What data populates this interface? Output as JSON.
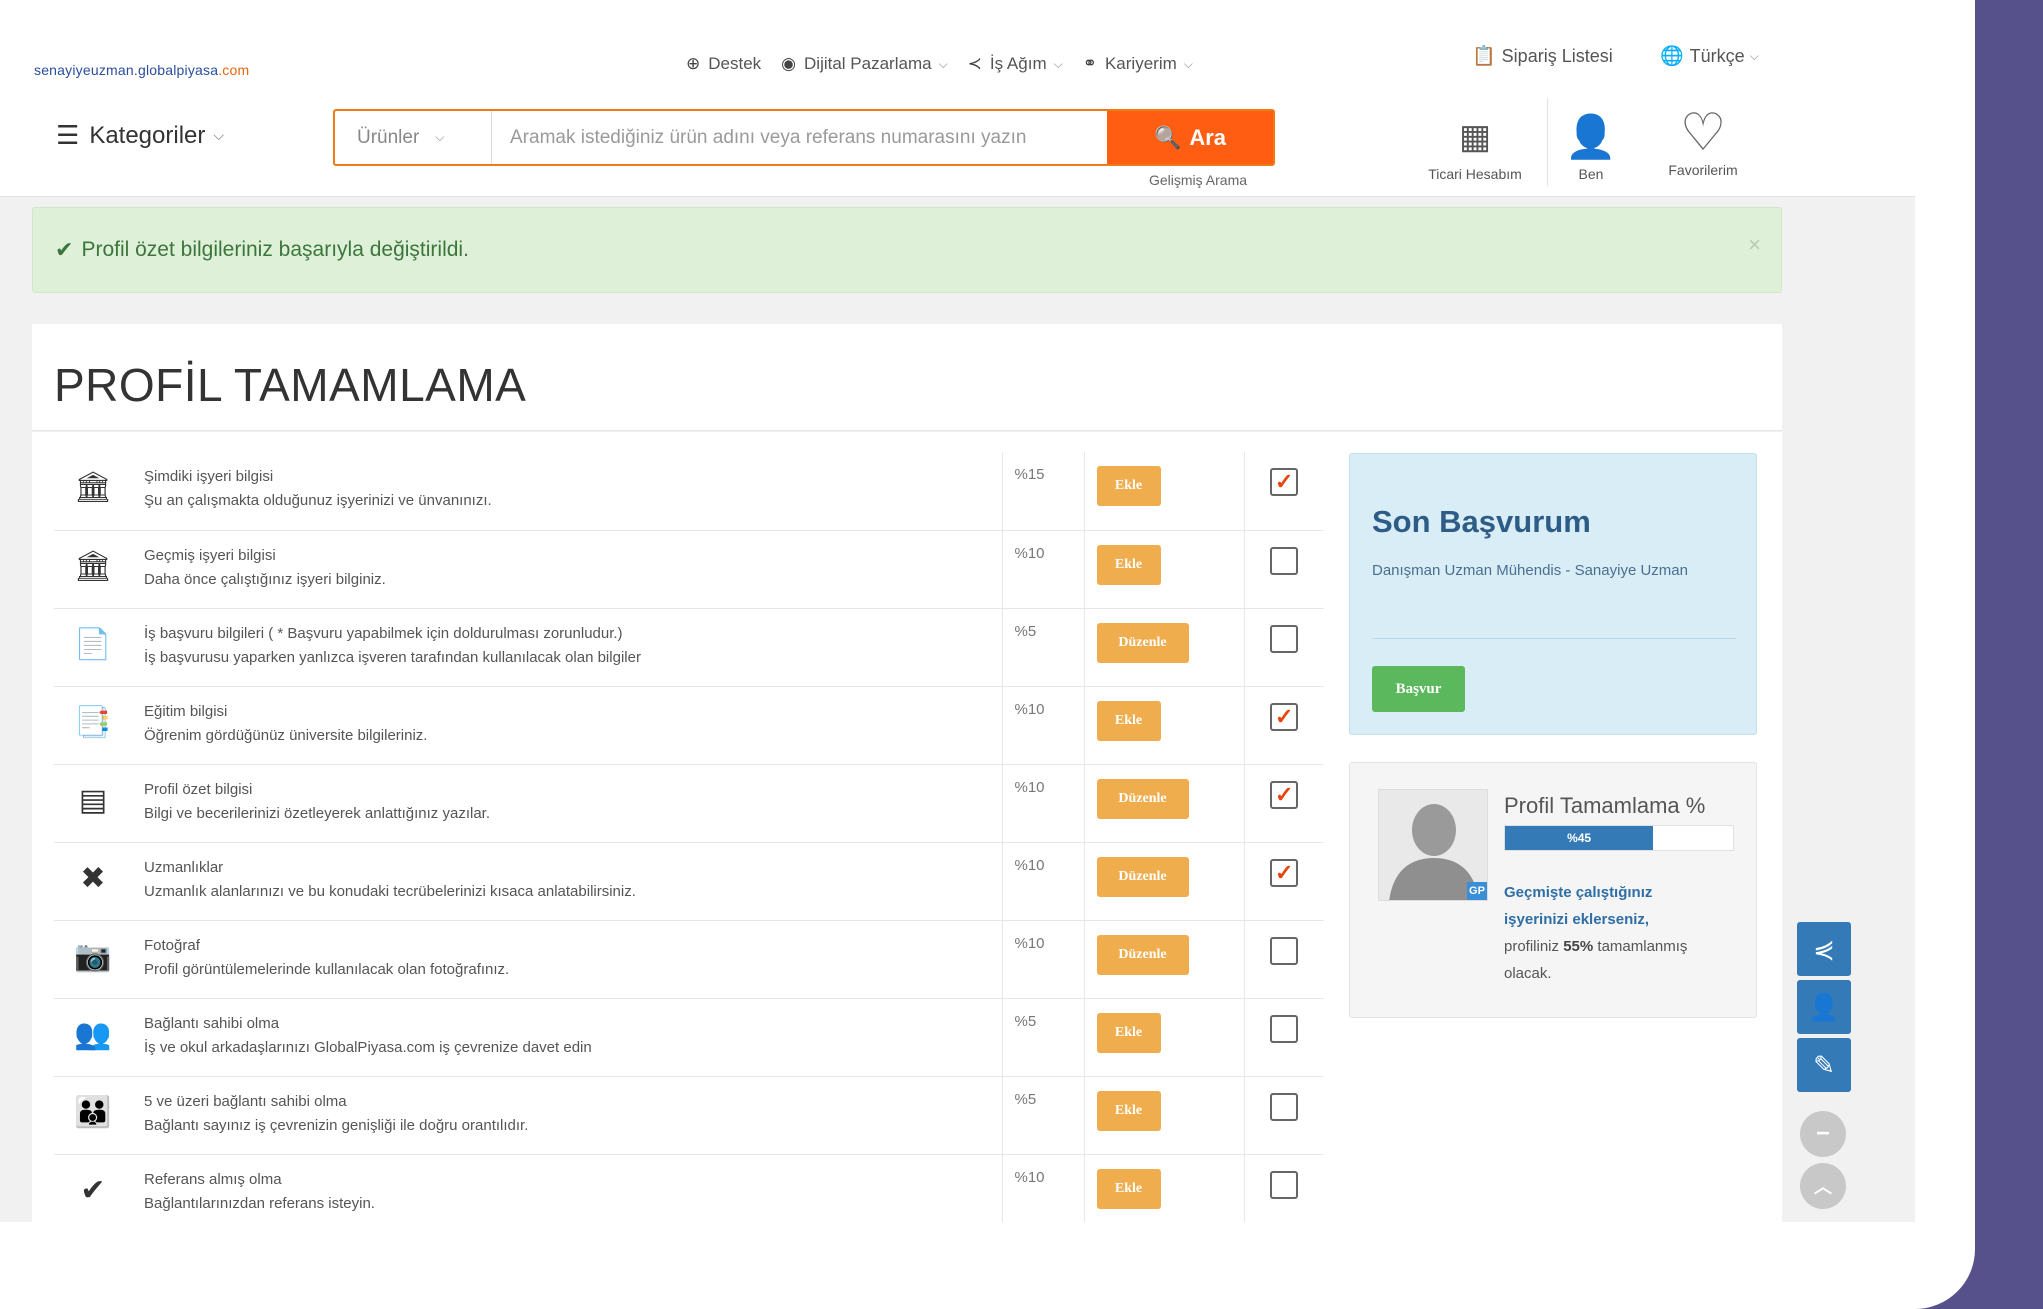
{
  "header": {
    "logo_prefix": "senayiyeuzman.globalpiyasa",
    "logo_domain": ".com",
    "nav": [
      {
        "label": "Destek",
        "icon": "⊕",
        "chevron": ""
      },
      {
        "label": "Dijital Pazarlama",
        "icon": "◉",
        "chevron": "⌵"
      },
      {
        "label": "İş Ağım",
        "icon": "≺",
        "chevron": "⌵"
      },
      {
        "label": "Kariyerim",
        "icon": "⚭",
        "chevron": "⌵"
      }
    ],
    "order_list": "Sipariş Listesi",
    "language": "Türkçe",
    "categories": "Kategoriler",
    "search_category": "Ürünler",
    "search_placeholder": "Aramak istediğiniz ürün adını veya referans numarasını yazın",
    "search_button": "Ara",
    "advanced_search": "Gelişmiş Arama",
    "account_label": "Ticari Hesabım",
    "me_label": "Ben",
    "favorites_label": "Favorilerim"
  },
  "alert": {
    "message": "Profil özet bilgileriniz başarıyla değiştirildi.",
    "close": "×"
  },
  "profile": {
    "title": "PROFİL TAMAMLAMA",
    "tasks": [
      {
        "icon": "🏛",
        "title": "Şimdiki işyeri bilgisi",
        "desc": "Şu an çalışmakta olduğunuz işyerinizi ve ünvanınızı.",
        "pct": "%15",
        "button": "Ekle",
        "checked": true
      },
      {
        "icon": "🏛",
        "title": "Geçmiş işyeri bilgisi",
        "desc": "Daha önce çalıştığınız işyeri bilginiz.",
        "pct": "%10",
        "button": "Ekle",
        "checked": false
      },
      {
        "icon": "📄",
        "title": "İş başvuru bilgileri ( * Başvuru yapabilmek için doldurulması zorunludur.)",
        "desc": "İş başvurusu yaparken yanlızca işveren tarafından kullanılacak olan bilgiler",
        "pct": "%5",
        "button": "Düzenle",
        "checked": false
      },
      {
        "icon": "📑",
        "title": "Eğitim bilgisi",
        "desc": "Öğrenim gördüğünüz üniversite bilgileriniz.",
        "pct": "%10",
        "button": "Ekle",
        "checked": true
      },
      {
        "icon": "▤",
        "title": "Profil özet bilgisi",
        "desc": "Bilgi ve becerilerinizi özetleyerek anlattığınız yazılar.",
        "pct": "%10",
        "button": "Düzenle",
        "checked": true
      },
      {
        "icon": "✖",
        "title": "Uzmanlıklar",
        "desc": "Uzmanlık alanlarınızı ve bu konudaki tecrübelerinizi kısaca anlatabilirsiniz.",
        "pct": "%10",
        "button": "Düzenle",
        "checked": true
      },
      {
        "icon": "📷",
        "title": "Fotoğraf",
        "desc": "Profil görüntülemelerinde kullanılacak olan fotoğrafınız.",
        "pct": "%10",
        "button": "Düzenle",
        "checked": false
      },
      {
        "icon": "👥",
        "title": "Bağlantı sahibi olma",
        "desc": "İş ve okul arkadaşlarınızı GlobalPiyasa.com iş çevrenize davet edin",
        "pct": "%5",
        "button": "Ekle",
        "checked": false
      },
      {
        "icon": "👪",
        "title": "5 ve üzeri bağlantı sahibi olma",
        "desc": "Bağlantı sayınız iş çevrenizin genişliği ile doğru orantılıdır.",
        "pct": "%5",
        "button": "Ekle",
        "checked": false
      },
      {
        "icon": "✔",
        "title": "Referans almış olma",
        "desc": "Bağlantılarınızdan referans isteyin.",
        "pct": "%10",
        "button": "Ekle",
        "checked": false
      }
    ]
  },
  "last_application": {
    "title": "Son Başvurum",
    "desc": "Danışman Uzman Mühendis - Sanayiye Uzman",
    "button": "Başvur"
  },
  "completion": {
    "title": "Profil Tamamlama %",
    "progress_label": "%45",
    "progress": 0.65,
    "msg_highlight": "Geçmişte çalıştığınız işyerinizi eklerseniz,",
    "msg_mid": "profiliniz",
    "msg_value": "55%",
    "msg_end": "tamamlanmış olacak.",
    "avatar_badge": "GP"
  },
  "colors": {
    "accent": "#ff5e12",
    "button": "#f0ad4e",
    "primary": "#337ab7",
    "success": "#5cb85c",
    "frame": "#56518a"
  }
}
